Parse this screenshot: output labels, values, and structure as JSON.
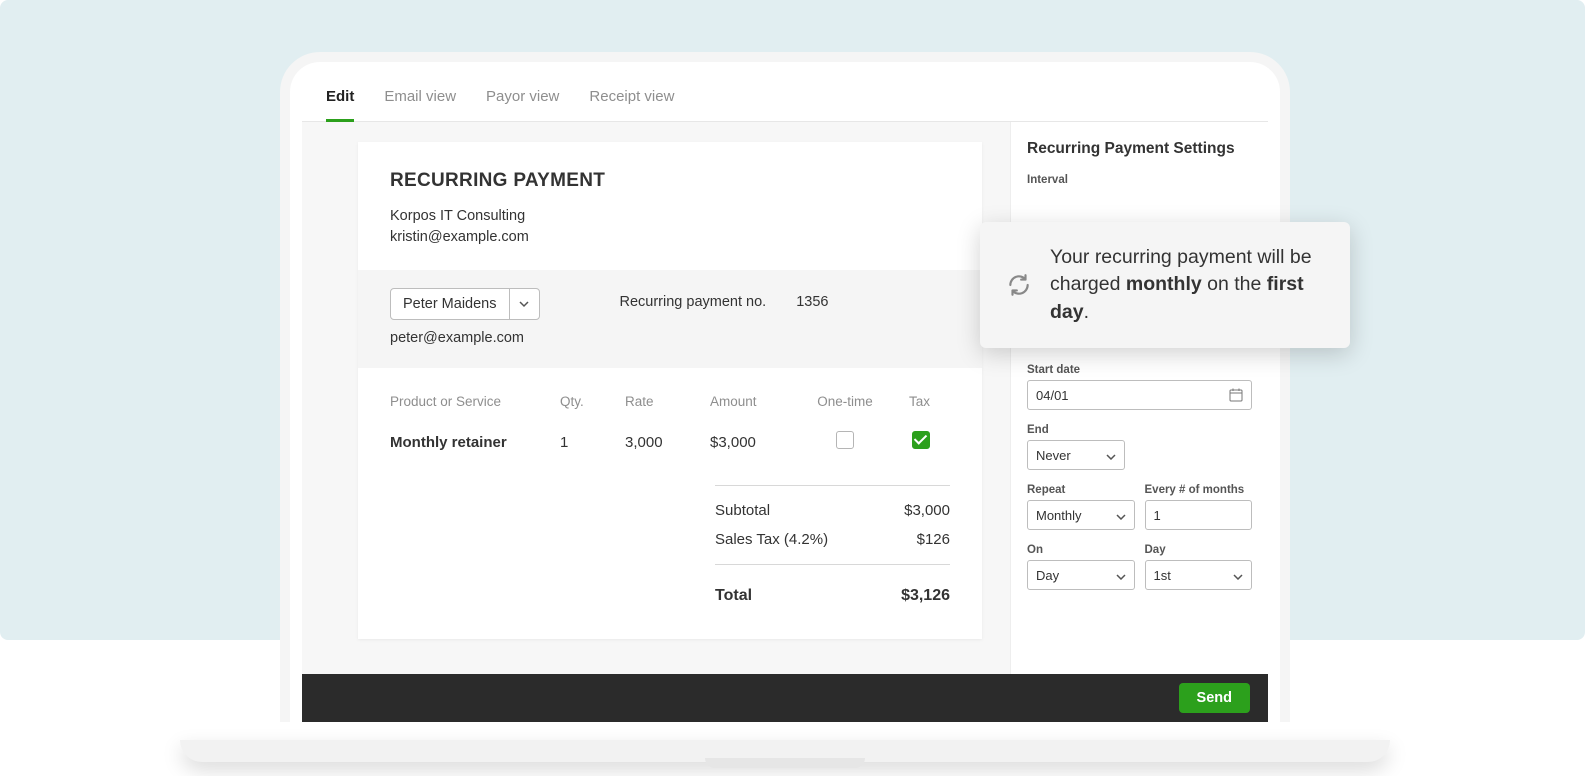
{
  "tabs": {
    "edit": "Edit",
    "email": "Email view",
    "payor": "Payor view",
    "receipt": "Receipt view"
  },
  "invoice": {
    "title": "RECURRING PAYMENT",
    "company": "Korpos IT Consulting",
    "email": "kristin@example.com",
    "payor_name": "Peter Maidens",
    "payor_email": "peter@example.com",
    "rp_label": "Recurring payment no.",
    "rp_number": "1356"
  },
  "columns": {
    "prod": "Product or Service",
    "qty": "Qty.",
    "rate": "Rate",
    "amount": "Amount",
    "onetime": "One-time",
    "tax": "Tax"
  },
  "line": {
    "prod": "Monthly retainer",
    "qty": "1",
    "rate": "3,000",
    "amount": "$3,000"
  },
  "totals": {
    "subtotal_label": "Subtotal",
    "subtotal": "$3,000",
    "tax_label": "Sales Tax (4.2%)",
    "tax": "$126",
    "total_label": "Total",
    "total": "$3,126"
  },
  "settings": {
    "title": "Recurring Payment Settings",
    "interval_label": "Interval",
    "start_label": "Start date",
    "start_value": "04/01",
    "end_label": "End",
    "end_value": "Never",
    "repeat_label": "Repeat",
    "repeat_value": "Monthly",
    "every_label": "Every # of months",
    "every_value": "1",
    "on_label": "On",
    "on_value": "Day",
    "day_label": "Day",
    "day_value": "1st"
  },
  "tooltip": {
    "pre": "Your recurring payment will be charged ",
    "b1": "monthly",
    "mid": " on the ",
    "b2": "first day",
    "post": "."
  },
  "footer": {
    "send": "Send"
  }
}
